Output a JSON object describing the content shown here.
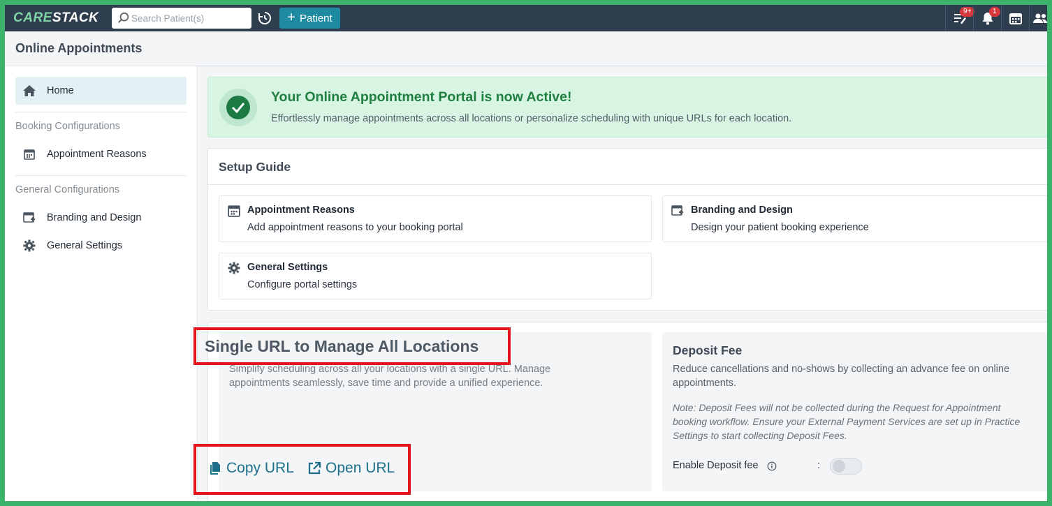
{
  "topbar": {
    "logo_care": "CARE",
    "logo_stack": "STACK",
    "search_placeholder": "Search Patient(s)",
    "add_patient_label": "Patient",
    "tasks_badge": "9+",
    "notifications_badge": "1"
  },
  "page": {
    "title": "Online Appointments"
  },
  "sidebar": {
    "home": "Home",
    "booking_section": "Booking Configurations",
    "appointment_reasons": "Appointment Reasons",
    "general_section": "General Configurations",
    "branding": "Branding and Design",
    "general_settings": "General Settings"
  },
  "banner": {
    "title": "Your Online Appointment Portal is now Active!",
    "subtitle": "Effortlessly manage appointments across all locations or personalize scheduling with unique URLs for each location."
  },
  "setup_guide": {
    "title": "Setup Guide",
    "cards": [
      {
        "title": "Appointment Reasons",
        "desc": "Add appointment reasons to your booking portal"
      },
      {
        "title": "Branding and Design",
        "desc": "Design your patient booking experience"
      },
      {
        "title": "General Settings",
        "desc": "Configure portal settings"
      }
    ]
  },
  "single_url": {
    "title": "Single URL to Manage All Locations",
    "desc": "Simplify scheduling across all your locations with a single URL. Manage appointments seamlessly, save time and provide a unified experience.",
    "copy_label": "Copy URL",
    "open_label": "Open URL"
  },
  "deposit": {
    "title": "Deposit Fee",
    "desc": "Reduce cancellations and no-shows by collecting an advance fee on online appointments.",
    "note": "Note: Deposit Fees will not be collected during the Request for Appointment booking workflow. Ensure your External Payment Services are set up in Practice Settings to start collecting Deposit Fees.",
    "enable_label": "Enable Deposit fee",
    "colon": ":",
    "enabled": false
  },
  "colors": {
    "topbar": "#2f3e4e",
    "accent": "#1e8ba2",
    "success": "#1f7f3f",
    "highlight": "#e3141b"
  }
}
